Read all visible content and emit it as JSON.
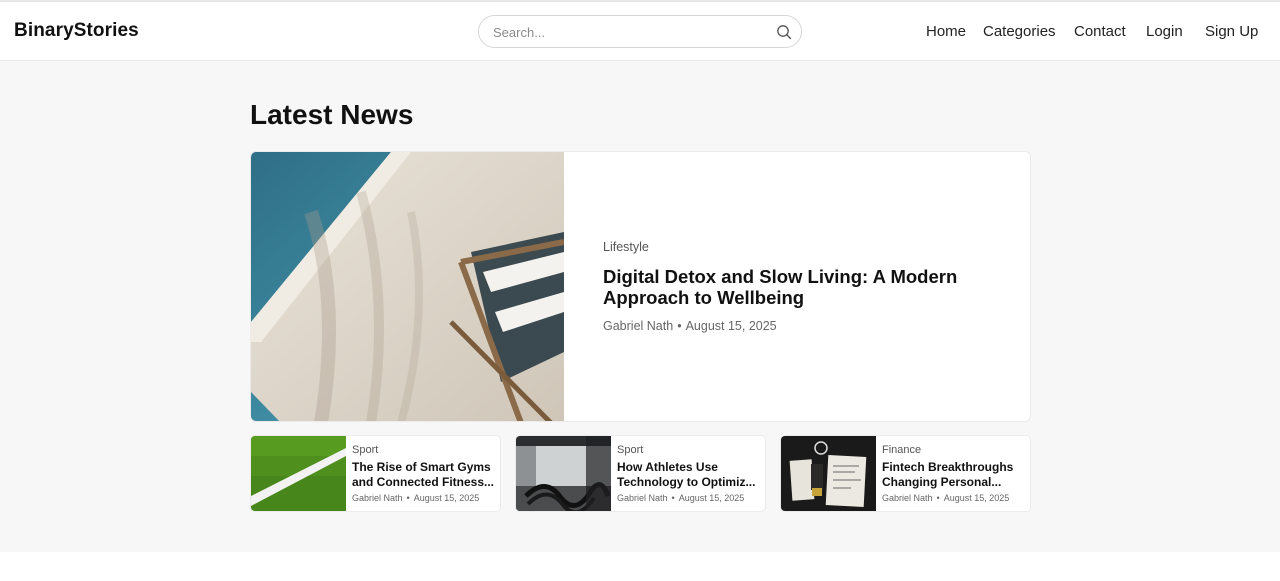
{
  "header": {
    "logo": "BinaryStories",
    "search_placeholder": "Search...",
    "nav": [
      "Home",
      "Categories",
      "Contact",
      "Login",
      "Sign Up"
    ]
  },
  "main": {
    "title": "Latest News",
    "featured": {
      "category": "Lifestyle",
      "title": "Digital Detox and Slow Living: A Modern Approach to Wellbeing",
      "author": "Gabriel Nath",
      "separator": "•",
      "date": "August 15, 2025"
    },
    "cards": [
      {
        "category": "Sport",
        "title_line1": "The Rise of Smart Gyms",
        "title_line2": "and Connected Fitness...",
        "author": "Gabriel Nath",
        "separator": "•",
        "date": "August 15, 2025",
        "image": "soccer-field-line"
      },
      {
        "category": "Sport",
        "title_line1": "How Athletes Use",
        "title_line2": "Technology to Optimiz...",
        "author": "Gabriel Nath",
        "separator": "•",
        "date": "August 15, 2025",
        "image": "battle-ropes-gym"
      },
      {
        "category": "Finance",
        "title_line1": "Fintech Breakthroughs",
        "title_line2": "Changing Personal...",
        "author": "Gabriel Nath",
        "separator": "•",
        "date": "August 15, 2025",
        "image": "desk-documents"
      }
    ]
  },
  "icons": {
    "search": "search-icon"
  },
  "colors": {
    "background": "#f7f7f8",
    "card": "#ffffff",
    "text": "#111111",
    "muted": "#666666"
  }
}
